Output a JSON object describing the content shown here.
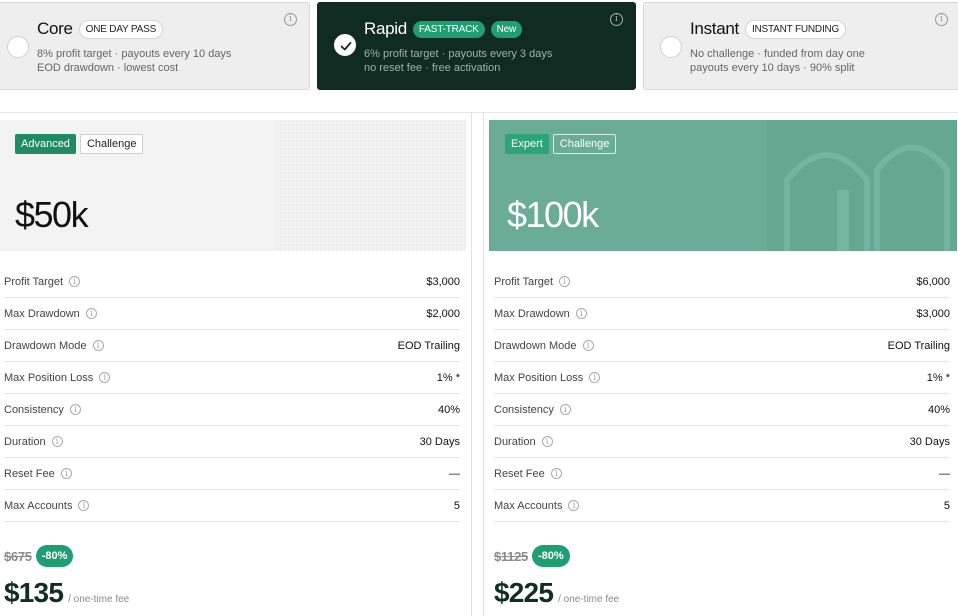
{
  "plans": [
    {
      "name": "Core",
      "badge": "ONE DAY PASS",
      "desc1": "8% profit target · payouts every 10 days",
      "desc2": "EOD drawdown · lowest cost",
      "selected": false
    },
    {
      "name": "Rapid",
      "badge": "FAST-TRACK",
      "badge2": "New",
      "desc1": "6% profit target · payouts every 3 days",
      "desc2": "no reset fee · free activation",
      "selected": true
    },
    {
      "name": "Instant",
      "badge": "INSTANT FUNDING",
      "desc1": "No challenge · funded from day one",
      "desc2": "payouts every 10 days · 90% split",
      "selected": false
    }
  ],
  "info_glyph": "i",
  "cards": [
    {
      "tag1": "Advanced",
      "tag2": "Challenge",
      "size": "$50k",
      "stats": [
        {
          "label": "Profit Target",
          "value": "$3,000"
        },
        {
          "label": "Max Drawdown",
          "value": "$2,000"
        },
        {
          "label": "Drawdown Mode",
          "value": "EOD Trailing"
        },
        {
          "label": "Max Position Loss",
          "value": "1% *"
        },
        {
          "label": "Consistency",
          "value": "40%"
        },
        {
          "label": "Duration",
          "value": "30 Days"
        },
        {
          "label": "Reset Fee",
          "value": "—"
        },
        {
          "label": "Max Accounts",
          "value": "5"
        }
      ],
      "old_price": "$675",
      "discount": "-80%",
      "price": "$135",
      "fee_note": "/ one-time fee"
    },
    {
      "tag1": "Expert",
      "tag2": "Challenge",
      "size": "$100k",
      "stats": [
        {
          "label": "Profit Target",
          "value": "$6,000"
        },
        {
          "label": "Max Drawdown",
          "value": "$3,000"
        },
        {
          "label": "Drawdown Mode",
          "value": "EOD Trailing"
        },
        {
          "label": "Max Position Loss",
          "value": "1% *"
        },
        {
          "label": "Consistency",
          "value": "40%"
        },
        {
          "label": "Duration",
          "value": "30 Days"
        },
        {
          "label": "Reset Fee",
          "value": "—"
        },
        {
          "label": "Max Accounts",
          "value": "5"
        }
      ],
      "old_price": "$1125",
      "discount": "-80%",
      "price": "$225",
      "fee_note": "/ one-time fee"
    }
  ],
  "colors": {
    "dark_green": "#102b22",
    "accent_green": "#1f9e72",
    "hero_green": "#6aac95"
  }
}
